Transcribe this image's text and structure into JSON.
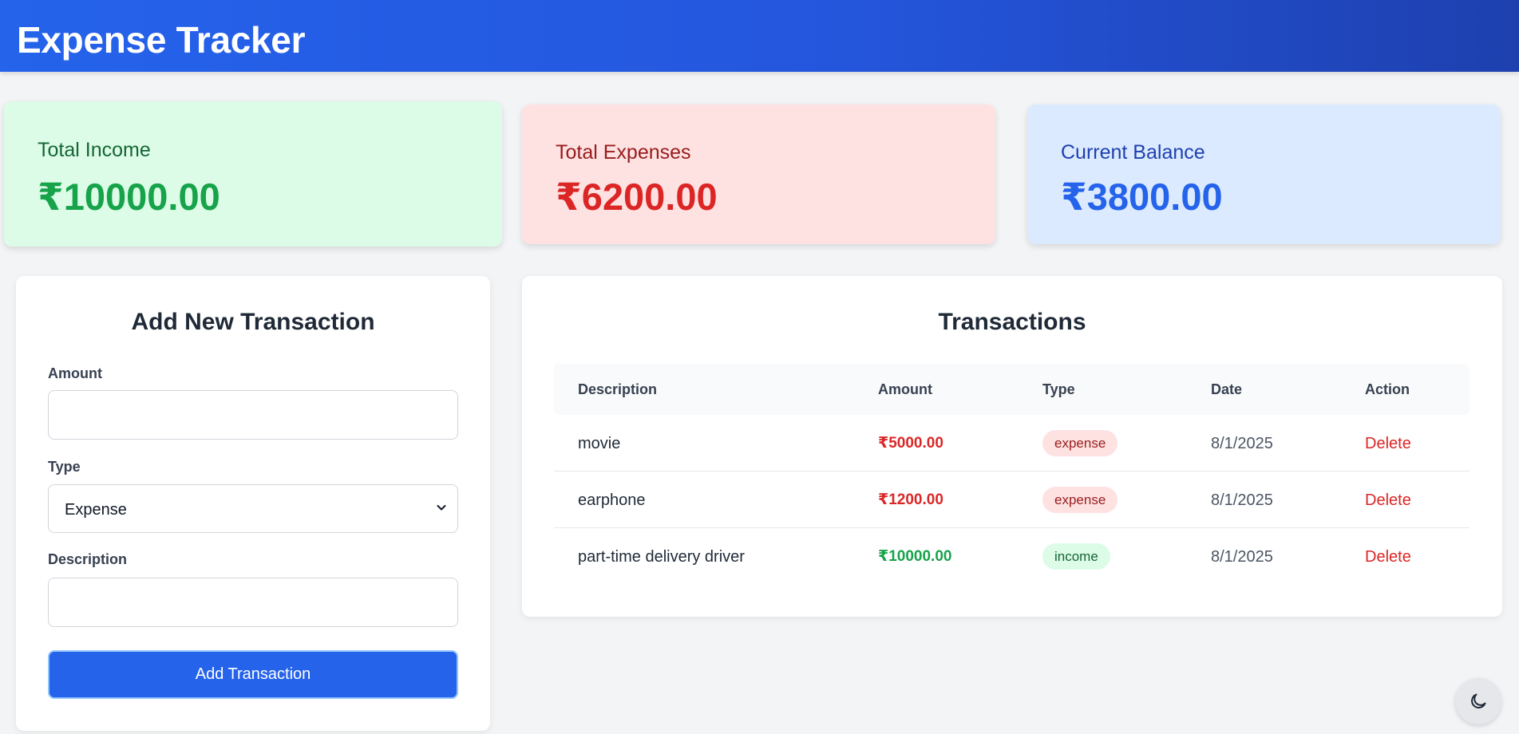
{
  "header": {
    "title": "Expense Tracker"
  },
  "summary": {
    "income": {
      "label": "Total Income",
      "value": "₹10000.00"
    },
    "expenses": {
      "label": "Total Expenses",
      "value": "₹6200.00"
    },
    "balance": {
      "label": "Current Balance",
      "value": "₹3800.00"
    }
  },
  "form": {
    "title": "Add New Transaction",
    "amount_label": "Amount",
    "amount_value": "",
    "type_label": "Type",
    "type_selected": "Expense",
    "description_label": "Description",
    "description_value": "",
    "submit_label": "Add Transaction"
  },
  "transactions": {
    "title": "Transactions",
    "columns": [
      "Description",
      "Amount",
      "Type",
      "Date",
      "Action"
    ],
    "rows": [
      {
        "description": "movie",
        "amount": "₹5000.00",
        "type": "expense",
        "date": "8/1/2025",
        "action": "Delete"
      },
      {
        "description": "earphone",
        "amount": "₹1200.00",
        "type": "expense",
        "date": "8/1/2025",
        "action": "Delete"
      },
      {
        "description": "part-time delivery driver",
        "amount": "₹10000.00",
        "type": "income",
        "date": "8/1/2025",
        "action": "Delete"
      }
    ]
  },
  "theme_toggle": {
    "icon": "moon-icon"
  },
  "colors": {
    "primary": "#2563eb",
    "income": "#16a34a",
    "expense": "#dc2626",
    "balance": "#2563eb"
  }
}
